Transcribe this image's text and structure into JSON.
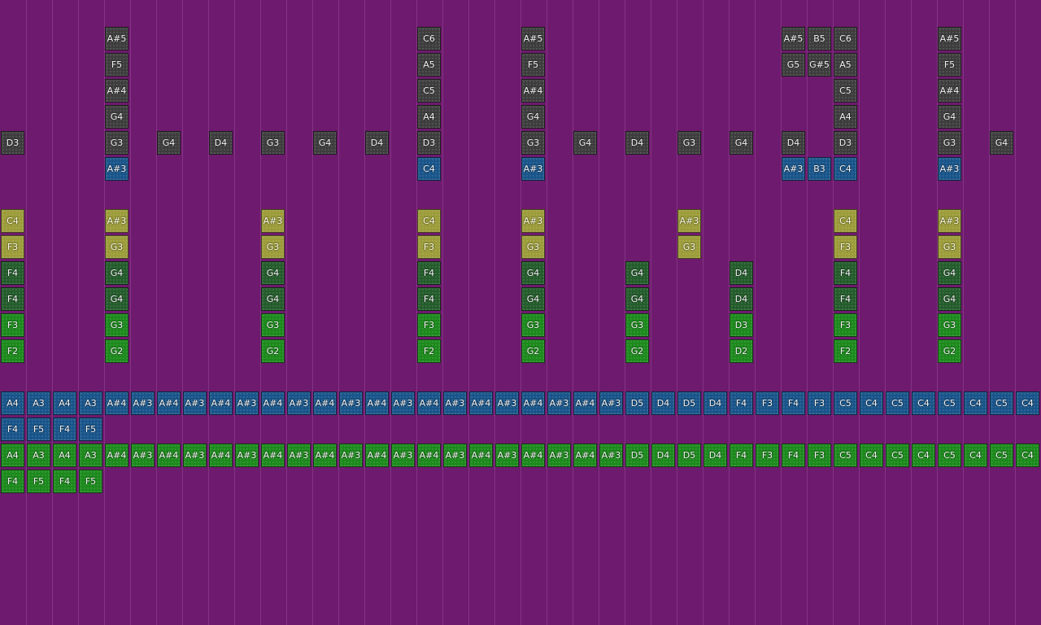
{
  "colors": {
    "background": "#6e1a6e",
    "grid_line": "#8a3a8a",
    "dark": "#3d3d3d",
    "blue": "#19558a",
    "yellow": "#9c9c3a",
    "dkgreen": "#245c2c",
    "green": "#1c8a1c"
  },
  "rows": [
    {
      "color": "dark",
      "cells": [
        [
          4,
          "A#5"
        ],
        [
          16,
          "C6"
        ],
        [
          20,
          "A#5"
        ],
        [
          30,
          "A#5"
        ],
        [
          31,
          "B5"
        ],
        [
          32,
          "C6"
        ],
        [
          36,
          "A#5"
        ]
      ]
    },
    {
      "color": "dark",
      "cells": [
        [
          4,
          "F5"
        ],
        [
          16,
          "A5"
        ],
        [
          20,
          "F5"
        ],
        [
          30,
          "G5"
        ],
        [
          31,
          "G#5"
        ],
        [
          32,
          "A5"
        ],
        [
          36,
          "F5"
        ]
      ]
    },
    {
      "color": "dark",
      "cells": [
        [
          4,
          "A#4"
        ],
        [
          16,
          "C5"
        ],
        [
          20,
          "A#4"
        ],
        [
          32,
          "C5"
        ],
        [
          36,
          "A#4"
        ]
      ]
    },
    {
      "color": "dark",
      "cells": [
        [
          4,
          "G4"
        ],
        [
          16,
          "A4"
        ],
        [
          20,
          "G4"
        ],
        [
          32,
          "A4"
        ],
        [
          36,
          "G4"
        ]
      ]
    },
    {
      "color": "dark",
      "cells": [
        [
          0,
          "D3"
        ],
        [
          4,
          "G3"
        ],
        [
          6,
          "G4"
        ],
        [
          8,
          "D4"
        ],
        [
          10,
          "G3"
        ],
        [
          12,
          "G4"
        ],
        [
          14,
          "D4"
        ],
        [
          16,
          "D3"
        ],
        [
          20,
          "G3"
        ],
        [
          22,
          "G4"
        ],
        [
          24,
          "D4"
        ],
        [
          26,
          "G3"
        ],
        [
          28,
          "G4"
        ],
        [
          30,
          "D4"
        ],
        [
          32,
          "D3"
        ],
        [
          36,
          "G3"
        ],
        [
          38,
          "G4"
        ]
      ]
    },
    {
      "color": "blue",
      "cells": [
        [
          4,
          "A#3"
        ],
        [
          16,
          "C4"
        ],
        [
          20,
          "A#3"
        ],
        [
          30,
          "A#3"
        ],
        [
          31,
          "B3"
        ],
        [
          32,
          "C4"
        ],
        [
          36,
          "A#3"
        ]
      ]
    },
    {
      "color": "none",
      "cells": []
    },
    {
      "color": "yellow",
      "cells": [
        [
          0,
          "C4"
        ],
        [
          4,
          "A#3"
        ],
        [
          10,
          "A#3"
        ],
        [
          16,
          "C4"
        ],
        [
          20,
          "A#3"
        ],
        [
          26,
          "A#3"
        ],
        [
          32,
          "C4"
        ],
        [
          36,
          "A#3"
        ]
      ]
    },
    {
      "color": "yellow",
      "cells": [
        [
          0,
          "F3"
        ],
        [
          4,
          "G3"
        ],
        [
          10,
          "G3"
        ],
        [
          16,
          "F3"
        ],
        [
          20,
          "G3"
        ],
        [
          26,
          "G3"
        ],
        [
          32,
          "F3"
        ],
        [
          36,
          "G3"
        ]
      ]
    },
    {
      "color": "dkgreen",
      "cells": [
        [
          0,
          "F4"
        ],
        [
          4,
          "G4"
        ],
        [
          10,
          "G4"
        ],
        [
          16,
          "F4"
        ],
        [
          20,
          "G4"
        ],
        [
          24,
          "G4"
        ],
        [
          28,
          "D4"
        ],
        [
          32,
          "F4"
        ],
        [
          36,
          "G4"
        ]
      ]
    },
    {
      "color": "dkgreen",
      "cells": [
        [
          0,
          "F4"
        ],
        [
          4,
          "G4"
        ],
        [
          10,
          "G4"
        ],
        [
          16,
          "F4"
        ],
        [
          20,
          "G4"
        ],
        [
          24,
          "G4"
        ],
        [
          28,
          "D4"
        ],
        [
          32,
          "F4"
        ],
        [
          36,
          "G4"
        ]
      ]
    },
    {
      "color": "green",
      "cells": [
        [
          0,
          "F3"
        ],
        [
          4,
          "G3"
        ],
        [
          10,
          "G3"
        ],
        [
          16,
          "F3"
        ],
        [
          20,
          "G3"
        ],
        [
          24,
          "G3"
        ],
        [
          28,
          "D3"
        ],
        [
          32,
          "F3"
        ],
        [
          36,
          "G3"
        ]
      ]
    },
    {
      "color": "green",
      "cells": [
        [
          0,
          "F2"
        ],
        [
          4,
          "G2"
        ],
        [
          10,
          "G2"
        ],
        [
          16,
          "F2"
        ],
        [
          20,
          "G2"
        ],
        [
          24,
          "G2"
        ],
        [
          28,
          "D2"
        ],
        [
          32,
          "F2"
        ],
        [
          36,
          "G2"
        ]
      ]
    },
    {
      "color": "none",
      "cells": []
    },
    {
      "color": "blue",
      "cells": [
        [
          0,
          "A4"
        ],
        [
          1,
          "A3"
        ],
        [
          2,
          "A4"
        ],
        [
          3,
          "A3"
        ],
        [
          4,
          "A#4"
        ],
        [
          5,
          "A#3"
        ],
        [
          6,
          "A#4"
        ],
        [
          7,
          "A#3"
        ],
        [
          8,
          "A#4"
        ],
        [
          9,
          "A#3"
        ],
        [
          10,
          "A#4"
        ],
        [
          11,
          "A#3"
        ],
        [
          12,
          "A#4"
        ],
        [
          13,
          "A#3"
        ],
        [
          14,
          "A#4"
        ],
        [
          15,
          "A#3"
        ],
        [
          16,
          "A#4"
        ],
        [
          17,
          "A#3"
        ],
        [
          18,
          "A#4"
        ],
        [
          19,
          "A#3"
        ],
        [
          20,
          "A#4"
        ],
        [
          21,
          "A#3"
        ],
        [
          22,
          "A#4"
        ],
        [
          23,
          "A#3"
        ],
        [
          24,
          "D5"
        ],
        [
          25,
          "D4"
        ],
        [
          26,
          "D5"
        ],
        [
          27,
          "D4"
        ],
        [
          28,
          "F4"
        ],
        [
          29,
          "F3"
        ],
        [
          30,
          "F4"
        ],
        [
          31,
          "F3"
        ],
        [
          32,
          "C5"
        ],
        [
          33,
          "C4"
        ],
        [
          34,
          "C5"
        ],
        [
          35,
          "C4"
        ],
        [
          36,
          "C5"
        ],
        [
          37,
          "C4"
        ],
        [
          38,
          "C5"
        ],
        [
          39,
          "C4"
        ]
      ]
    },
    {
      "color": "blue",
      "cells": [
        [
          0,
          "F4"
        ],
        [
          1,
          "F5"
        ],
        [
          2,
          "F4"
        ],
        [
          3,
          "F5"
        ]
      ]
    },
    {
      "color": "green",
      "cells": [
        [
          0,
          "A4"
        ],
        [
          1,
          "A3"
        ],
        [
          2,
          "A4"
        ],
        [
          3,
          "A3"
        ],
        [
          4,
          "A#4"
        ],
        [
          5,
          "A#3"
        ],
        [
          6,
          "A#4"
        ],
        [
          7,
          "A#3"
        ],
        [
          8,
          "A#4"
        ],
        [
          9,
          "A#3"
        ],
        [
          10,
          "A#4"
        ],
        [
          11,
          "A#3"
        ],
        [
          12,
          "A#4"
        ],
        [
          13,
          "A#3"
        ],
        [
          14,
          "A#4"
        ],
        [
          15,
          "A#3"
        ],
        [
          16,
          "A#4"
        ],
        [
          17,
          "A#3"
        ],
        [
          18,
          "A#4"
        ],
        [
          19,
          "A#3"
        ],
        [
          20,
          "A#4"
        ],
        [
          21,
          "A#3"
        ],
        [
          22,
          "A#4"
        ],
        [
          23,
          "A#3"
        ],
        [
          24,
          "D5"
        ],
        [
          25,
          "D4"
        ],
        [
          26,
          "D5"
        ],
        [
          27,
          "D4"
        ],
        [
          28,
          "F4"
        ],
        [
          29,
          "F3"
        ],
        [
          30,
          "F4"
        ],
        [
          31,
          "F3"
        ],
        [
          32,
          "C5"
        ],
        [
          33,
          "C4"
        ],
        [
          34,
          "C5"
        ],
        [
          35,
          "C4"
        ],
        [
          36,
          "C5"
        ],
        [
          37,
          "C4"
        ],
        [
          38,
          "C5"
        ],
        [
          39,
          "C4"
        ]
      ]
    },
    {
      "color": "green",
      "cells": [
        [
          0,
          "F4"
        ],
        [
          1,
          "F5"
        ],
        [
          2,
          "F4"
        ],
        [
          3,
          "F5"
        ]
      ]
    }
  ]
}
